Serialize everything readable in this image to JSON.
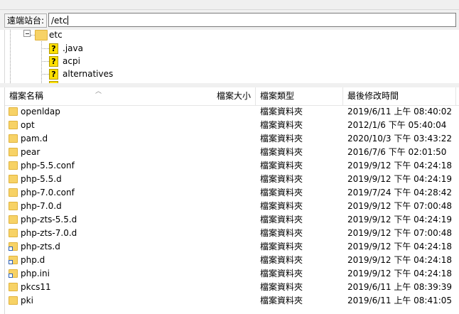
{
  "address": {
    "label": "遠端站台:",
    "path": "/etc"
  },
  "tree": {
    "root": "etc",
    "children": [
      ".java",
      "acpi",
      "alternatives"
    ]
  },
  "columns": {
    "name": "檔案名稱",
    "size": "檔案大小",
    "type": "檔案類型",
    "modified": "最後修改時間"
  },
  "files": [
    {
      "name": "openldap",
      "icon": "folder-icon",
      "type": "檔案資料夾",
      "modified": "2019/6/11 上午 08:40:02"
    },
    {
      "name": "opt",
      "icon": "folder-icon",
      "type": "檔案資料夾",
      "modified": "2012/1/6 下午 05:40:04"
    },
    {
      "name": "pam.d",
      "icon": "folder-icon",
      "type": "檔案資料夾",
      "modified": "2020/10/3 下午 03:43:22"
    },
    {
      "name": "pear",
      "icon": "folder-icon",
      "type": "檔案資料夾",
      "modified": "2016/7/6 下午 02:01:50"
    },
    {
      "name": "php-5.5.conf",
      "icon": "folder-icon",
      "type": "檔案資料夾",
      "modified": "2019/9/12 下午 04:24:18"
    },
    {
      "name": "php-5.5.d",
      "icon": "folder-icon",
      "type": "檔案資料夾",
      "modified": "2019/9/12 下午 04:24:19"
    },
    {
      "name": "php-7.0.conf",
      "icon": "folder-icon",
      "type": "檔案資料夾",
      "modified": "2019/7/24 下午 04:28:42"
    },
    {
      "name": "php-7.0.d",
      "icon": "folder-icon",
      "type": "檔案資料夾",
      "modified": "2019/9/12 下午 07:00:48"
    },
    {
      "name": "php-zts-5.5.d",
      "icon": "folder-icon",
      "type": "檔案資料夾",
      "modified": "2019/9/12 下午 04:24:19"
    },
    {
      "name": "php-zts-7.0.d",
      "icon": "folder-icon",
      "type": "檔案資料夾",
      "modified": "2019/9/12 下午 07:00:48"
    },
    {
      "name": "php-zts.d",
      "icon": "folder-link-icon",
      "type": "檔案資料夾",
      "modified": "2019/9/12 下午 04:24:18"
    },
    {
      "name": "php.d",
      "icon": "folder-link-icon",
      "type": "檔案資料夾",
      "modified": "2019/9/12 下午 04:24:18"
    },
    {
      "name": "php.ini",
      "icon": "folder-link-icon",
      "type": "檔案資料夾",
      "modified": "2019/9/12 下午 04:24:18"
    },
    {
      "name": "pkcs11",
      "icon": "folder-icon",
      "type": "檔案資料夾",
      "modified": "2019/6/11 上午 08:39:39"
    },
    {
      "name": "pki",
      "icon": "folder-icon",
      "type": "檔案資料夾",
      "modified": "2019/6/11 上午 08:41:05"
    }
  ]
}
